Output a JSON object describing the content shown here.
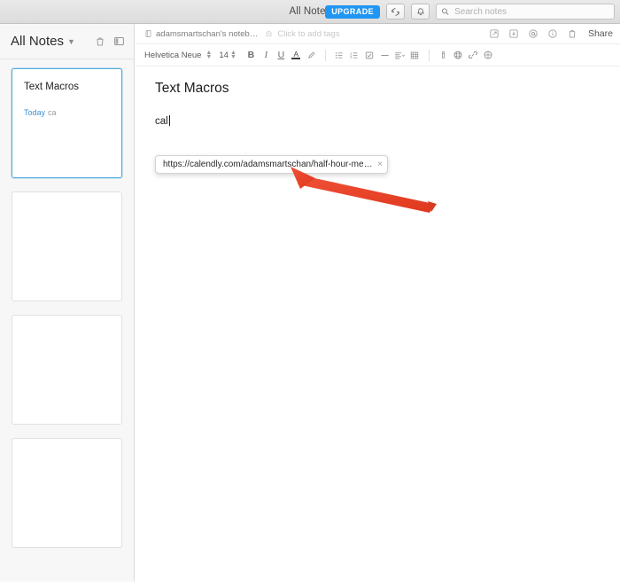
{
  "titlebar": {
    "title": "All Notes",
    "upgrade_label": "UPGRADE",
    "sync_icon": "sync-icon",
    "bell_icon": "bell-icon",
    "search": {
      "placeholder": "Search notes",
      "value": "",
      "icon": "search-icon"
    }
  },
  "sidebar": {
    "title": "All Notes",
    "chevron_icon": "chevron-down-icon",
    "header_icons": [
      {
        "name": "trash-icon"
      },
      {
        "name": "sidebar-toggle-icon"
      }
    ],
    "notes": [
      {
        "title": "Text Macros",
        "date": "Today",
        "snippet": "ca",
        "selected": true
      },
      {
        "title": "",
        "date": "",
        "snippet": "",
        "selected": false
      },
      {
        "title": "",
        "date": "",
        "snippet": "",
        "selected": false
      },
      {
        "title": "",
        "date": "",
        "snippet": "",
        "selected": false
      }
    ]
  },
  "note_header": {
    "notebook_icon": "notebook-icon",
    "notebook_name": "adamsmartschan's noteb…",
    "tag_icon": "tag-icon",
    "tags_placeholder": "Click to add tags",
    "actions": [
      {
        "name": "edit-in-new-window-icon"
      },
      {
        "name": "present-icon"
      },
      {
        "name": "mention-icon"
      },
      {
        "name": "info-icon"
      },
      {
        "name": "trash-icon"
      }
    ],
    "share_label": "Share"
  },
  "format_toolbar": {
    "font_family": "Helvetica Neue",
    "font_size": "14",
    "stepper_up": "▲",
    "stepper_down": "▼",
    "bold_label": "B",
    "italic_label": "I",
    "underline_label": "U",
    "text_color_label": "A",
    "highlight_icon": "highlighter-icon",
    "buttons": [
      {
        "name": "bullet-list-icon"
      },
      {
        "name": "numbered-list-icon"
      },
      {
        "name": "checklist-icon"
      },
      {
        "name": "horizontal-rule-icon"
      },
      {
        "name": "align-icon"
      },
      {
        "name": "table-icon"
      },
      {
        "name": "attachment-icon"
      },
      {
        "name": "web-clip-icon"
      },
      {
        "name": "link-icon"
      },
      {
        "name": "more-icon"
      }
    ]
  },
  "note": {
    "title": "Text Macros",
    "body_text": "cal"
  },
  "autocomplete": {
    "suggestion": "https://calendly.com/adamsmartschan/half-hour-meeting",
    "close_label": "×"
  },
  "annotation": {
    "arrow_color": "#e8402a",
    "arrow_name": "red-arrow-annotation"
  },
  "colors": {
    "accent_blue": "#2196f3",
    "selected_border": "#4fa8e0",
    "date_blue": "#3e8fd0",
    "arrow_red": "#e8402a"
  }
}
